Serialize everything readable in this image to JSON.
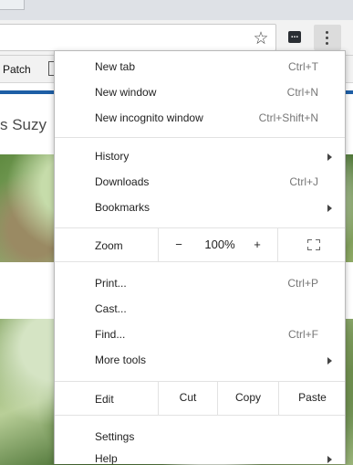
{
  "browser": {
    "bookmark_bar_label": "Patch",
    "page_title_fragment": "s Suzy"
  },
  "icons": {
    "star": "star-icon",
    "extension": "extension-icon",
    "menu": "three-dot-menu-icon",
    "fullscreen": "fullscreen-icon",
    "submenu_arrow": "chevron-right-icon"
  },
  "menu": {
    "new_tab": {
      "label": "New tab",
      "shortcut": "Ctrl+T"
    },
    "new_window": {
      "label": "New window",
      "shortcut": "Ctrl+N"
    },
    "new_incognito": {
      "label": "New incognito window",
      "shortcut": "Ctrl+Shift+N"
    },
    "history": {
      "label": "History"
    },
    "downloads": {
      "label": "Downloads",
      "shortcut": "Ctrl+J"
    },
    "bookmarks": {
      "label": "Bookmarks"
    },
    "zoom": {
      "label": "Zoom",
      "minus": "−",
      "value": "100%",
      "plus": "+"
    },
    "print": {
      "label": "Print...",
      "shortcut": "Ctrl+P"
    },
    "cast": {
      "label": "Cast..."
    },
    "find": {
      "label": "Find...",
      "shortcut": "Ctrl+F"
    },
    "more_tools": {
      "label": "More tools"
    },
    "edit": {
      "label": "Edit",
      "cut": "Cut",
      "copy": "Copy",
      "paste": "Paste"
    },
    "settings": {
      "label": "Settings"
    },
    "help": {
      "label": "Help"
    }
  },
  "colors": {
    "accent_bar": "#1e5fa6",
    "menu_button_bg": "#dcdcdc"
  }
}
